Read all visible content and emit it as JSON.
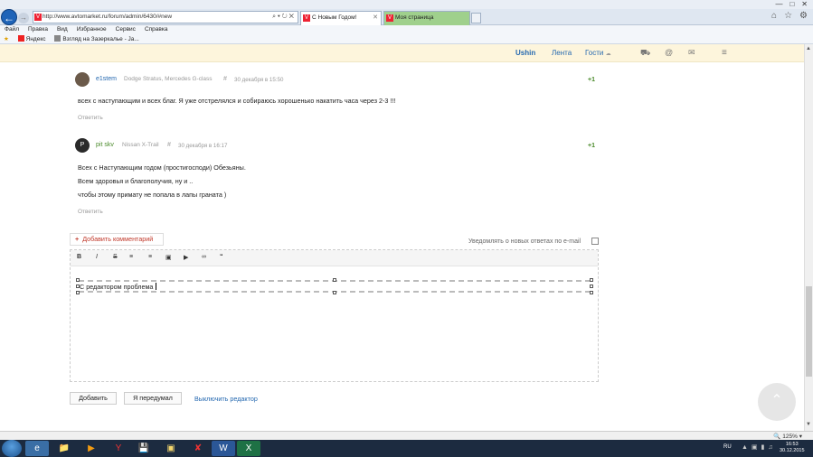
{
  "browser": {
    "title_faint": "",
    "address": "http://www.avtomarket.ru/forum/admin/6430/#new",
    "tabs": [
      {
        "label": "С Новым Годом! Официал..."
      },
      {
        "label": "Моя страница"
      }
    ],
    "menu": [
      "Файл",
      "Правка",
      "Вид",
      "Избранное",
      "Сервис",
      "Справка"
    ],
    "favorites": [
      "Яндекс",
      "Взгляд на Зазеркалье - Ja..."
    ],
    "zoom": "125%"
  },
  "site_header": {
    "user": "Ushin",
    "feed": "Лента",
    "guests": "Гости"
  },
  "comments": [
    {
      "author": "e1stem",
      "cars": "Dodge Stratus, Mercedes G-class",
      "hash": "#",
      "date": "30 декабря в 15:50",
      "rating": "+1",
      "lines": [
        "всех с наступающим и всех благ. Я уже отстрелялся и собираюсь хорошенько накатить часа через 2-3 !!!"
      ],
      "reply": "Ответить",
      "avatar_color": "#6b5a4a"
    },
    {
      "author": "pit skv",
      "cars": "Nissan X-Trail",
      "hash": "#",
      "date": "30 декабря в 16:17",
      "rating": "+1",
      "avatar_letter": "P",
      "lines": [
        "Всех с Наступающим годом (простигосподи) Обезьяны.",
        "Всем здоровья и благополучия, ну и ..",
        "чтобы этому примату не попала в лапы граната )"
      ],
      "reply": "Ответить",
      "avatar_color": "#2a2a2a"
    }
  ],
  "add_comment": {
    "label": "Добавить комментарий",
    "notify_label": "Уведомлять о новых ответах по e-mail"
  },
  "editor": {
    "toolbar": [
      "B",
      "I",
      "S",
      "ul",
      "ol",
      "img",
      "video",
      "link",
      "quote"
    ],
    "text": "С редактором проблема"
  },
  "buttons": {
    "submit": "Добавить",
    "cancel": "Я передумал",
    "disable": "Выключить редактор"
  },
  "taskbar": {
    "lang": "RU",
    "time": "16:53",
    "date": "30.12.2015"
  }
}
